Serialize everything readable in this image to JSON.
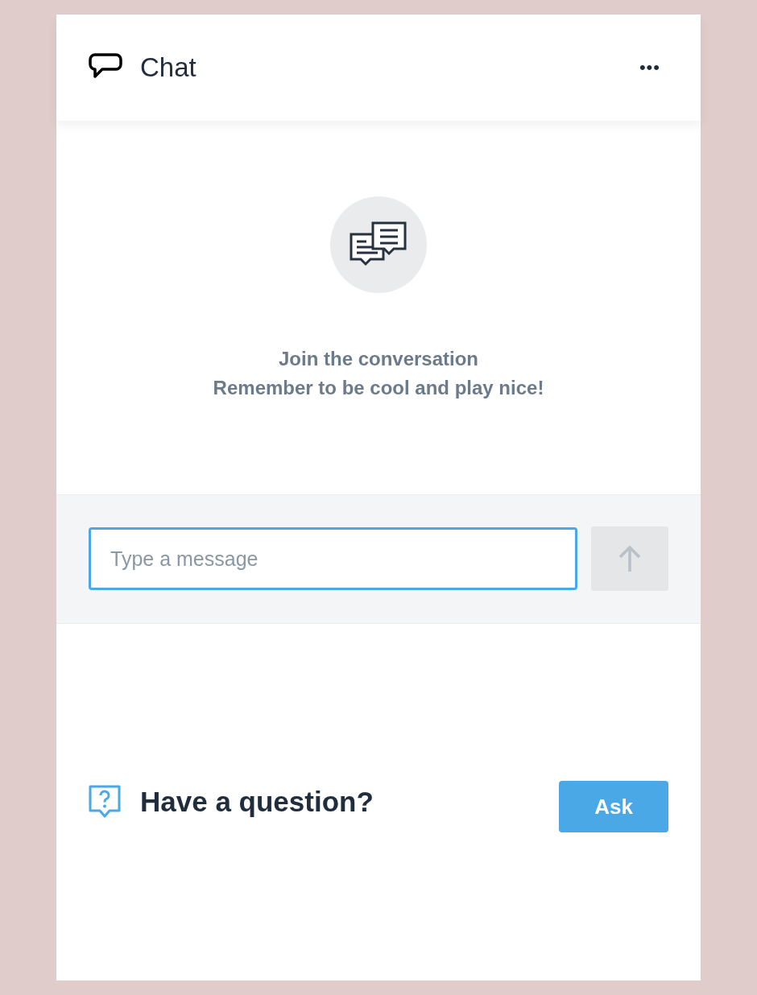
{
  "header": {
    "title": "Chat",
    "menu": "•••"
  },
  "empty_state": {
    "title": "Join the conversation",
    "subtitle": "Remember to be cool and play nice!"
  },
  "composer": {
    "placeholder": "Type a message",
    "send_disabled": true
  },
  "footer": {
    "prompt": "Have a question?",
    "button": "Ask"
  }
}
